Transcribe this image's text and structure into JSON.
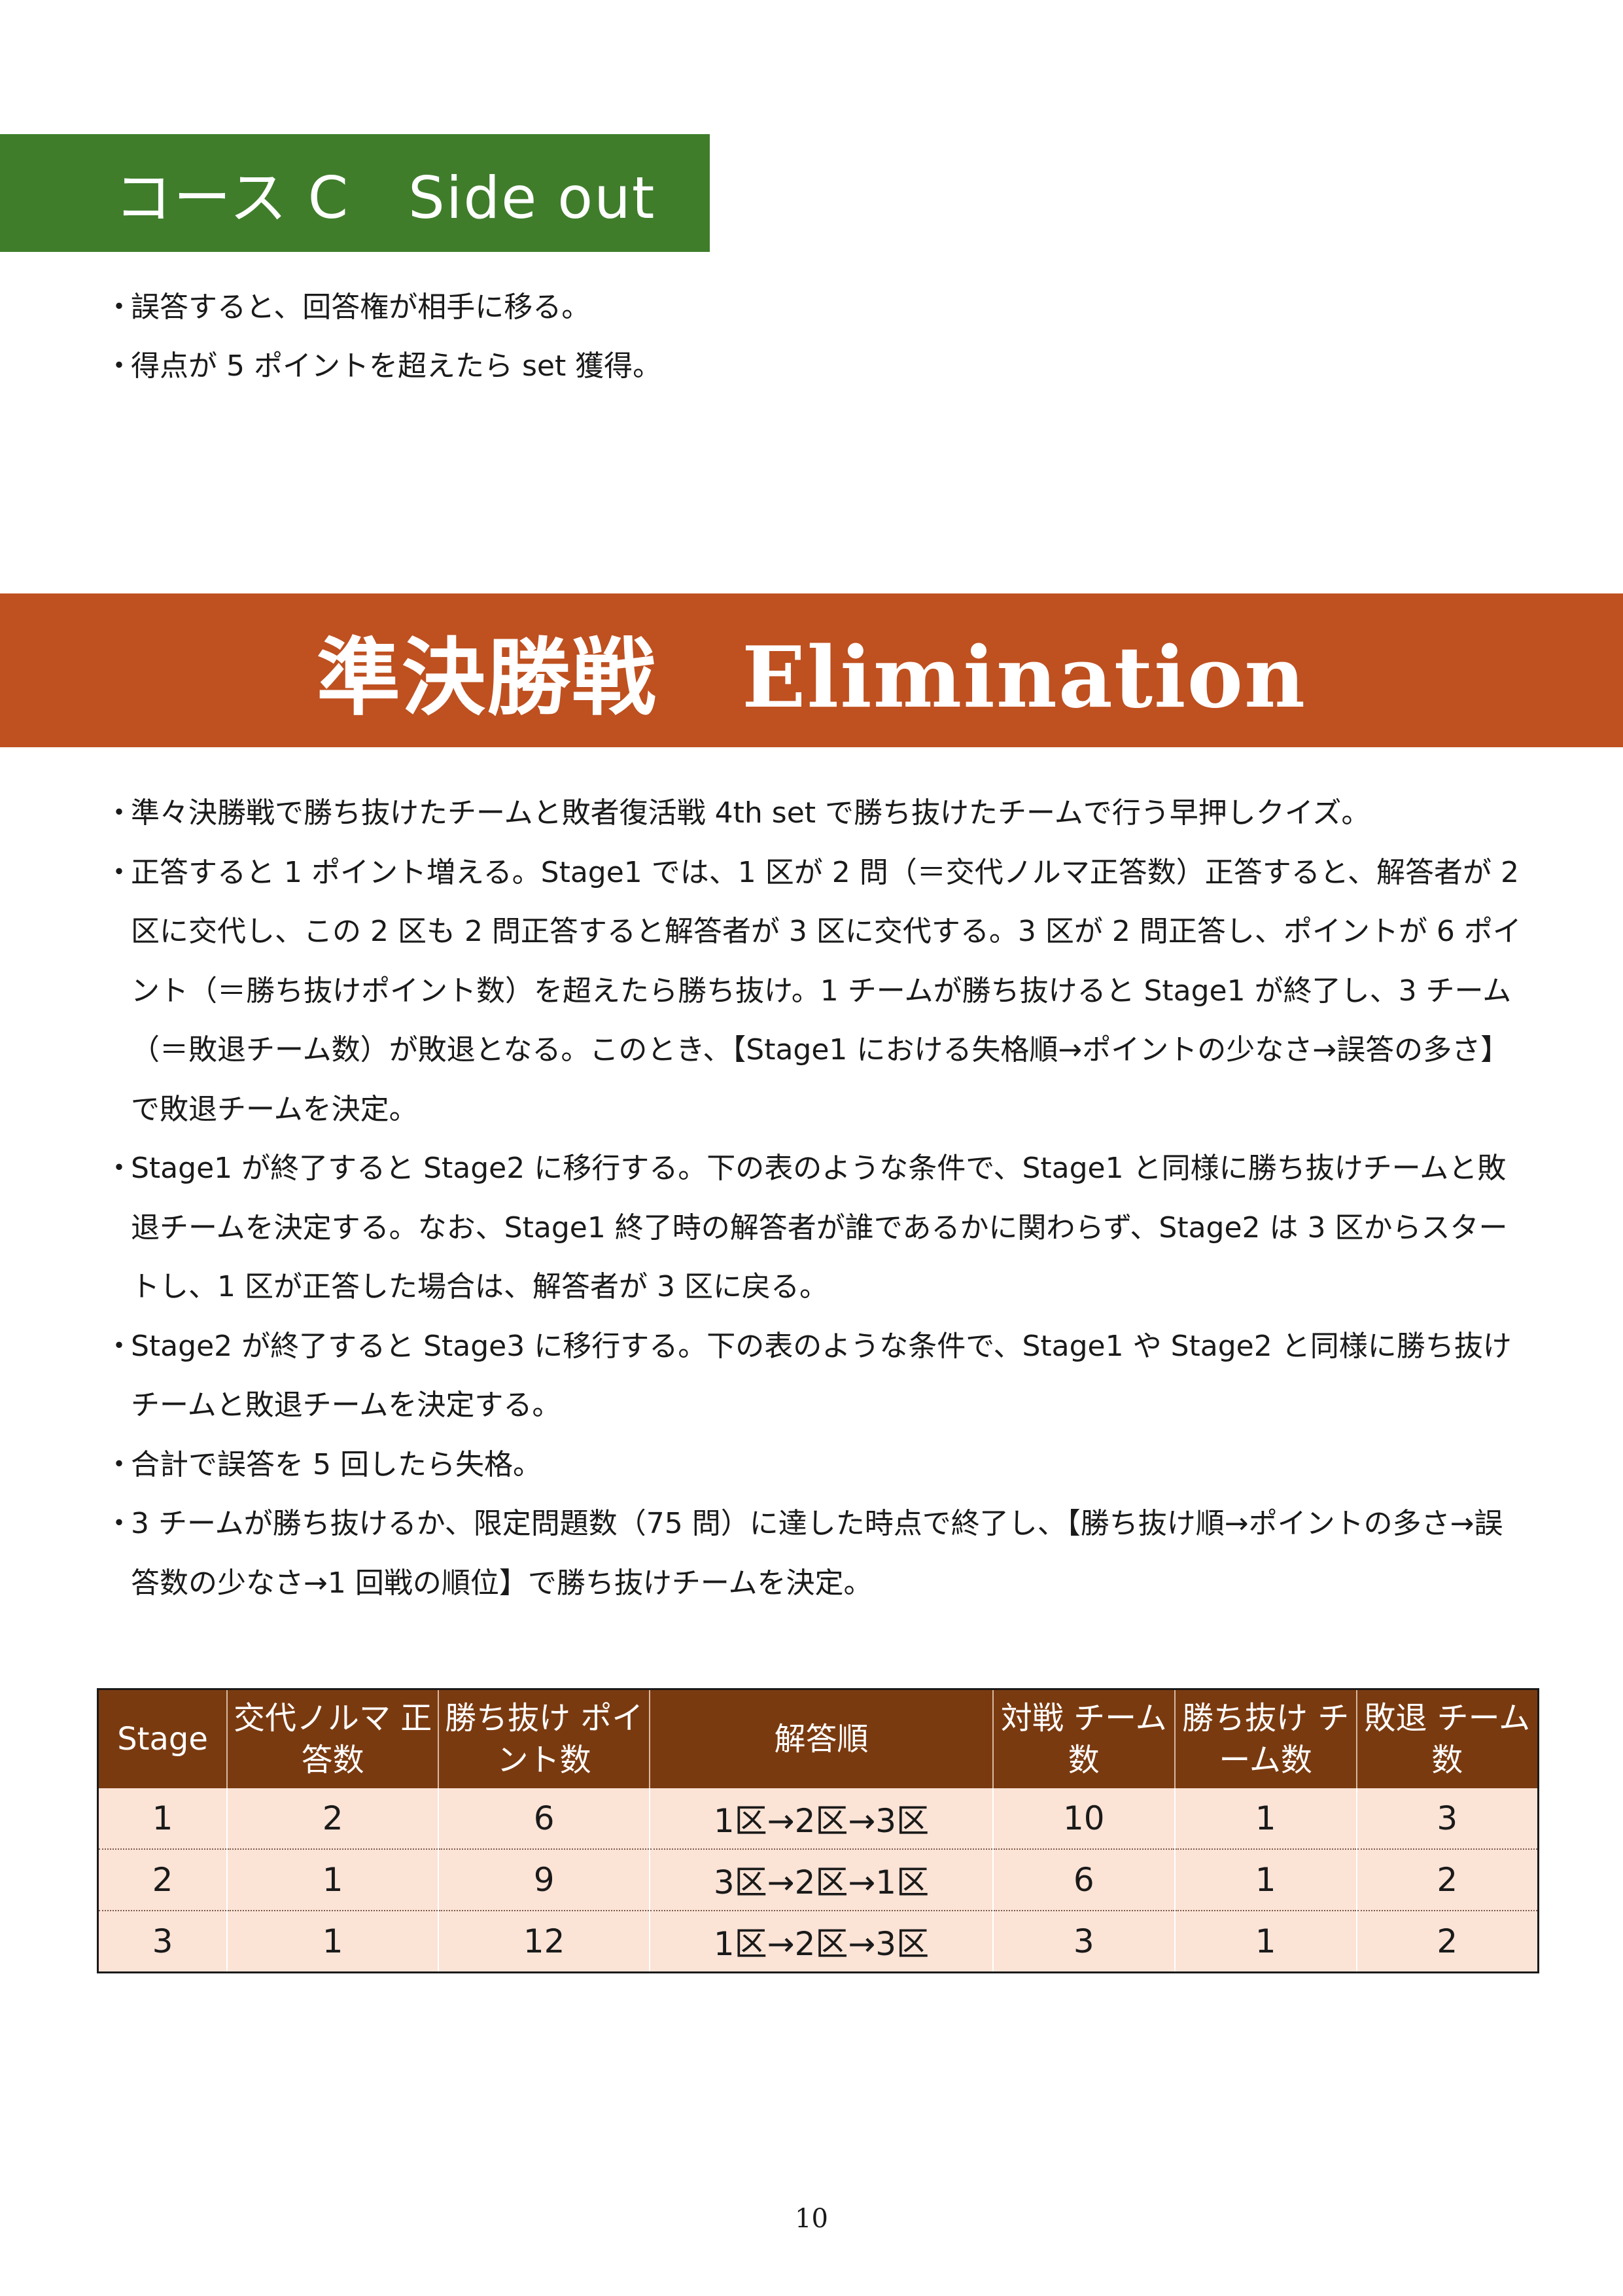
{
  "course_c": {
    "title": "コース C　Side out",
    "bullets": [
      "誤答すると、回答権が相手に移る。",
      "得点が 5 ポイントを超えたら set 獲得。"
    ]
  },
  "elimination": {
    "title": "準決勝戦　Elimination",
    "bullet_symbol": "・",
    "bullets": [
      "準々決勝戦で勝ち抜けたチームと敗者復活戦 4th set で勝ち抜けたチームで行う早押しクイズ。",
      "正答すると 1 ポイント増える。Stage1 では、1 区が 2 問（＝交代ノルマ正答数）正答すると、解答者が 2 区に交代し、この 2 区も 2 問正答すると解答者が 3 区に交代する。3 区が 2 問正答し、ポイントが 6 ポイント（＝勝ち抜けポイント数）を超えたら勝ち抜け。1 チームが勝ち抜けると Stage1 が終了し、3 チーム（＝敗退チーム数）が敗退となる。このとき、【Stage1 における失格順→ポイントの少なさ→誤答の多さ】で敗退チームを決定。",
      "Stage1 が終了すると Stage2 に移行する。下の表のような条件で、Stage1 と同様に勝ち抜けチームと敗退チームを決定する。なお、Stage1 終了時の解答者が誰であるかに関わらず、Stage2 は 3 区からスタートし、1 区が正答した場合は、解答者が 3 区に戻る。",
      "Stage2 が終了すると Stage3 に移行する。下の表のような条件で、Stage1 や Stage2 と同様に勝ち抜けチームと敗退チームを決定する。",
      "合計で誤答を 5 回したら失格。",
      "3 チームが勝ち抜けるか、限定問題数（75 問）に達した時点で終了し、【勝ち抜け順→ポイントの多さ→誤答数の少なさ→1 回戦の順位】で勝ち抜けチームを決定。"
    ]
  },
  "table": {
    "headers": [
      "Stage",
      "交代ノルマ 正答数",
      "勝ち抜け ポイント数",
      "解答順",
      "対戦 チーム数",
      "勝ち抜け チーム数",
      "敗退 チーム数"
    ],
    "rows": [
      [
        "1",
        "2",
        "6",
        "1区→2区→3区",
        "10",
        "1",
        "3"
      ],
      [
        "2",
        "1",
        "9",
        "3区→2区→1区",
        "6",
        "1",
        "2"
      ],
      [
        "3",
        "1",
        "12",
        "1区→2区→3区",
        "3",
        "1",
        "2"
      ]
    ]
  },
  "page_number": "10"
}
